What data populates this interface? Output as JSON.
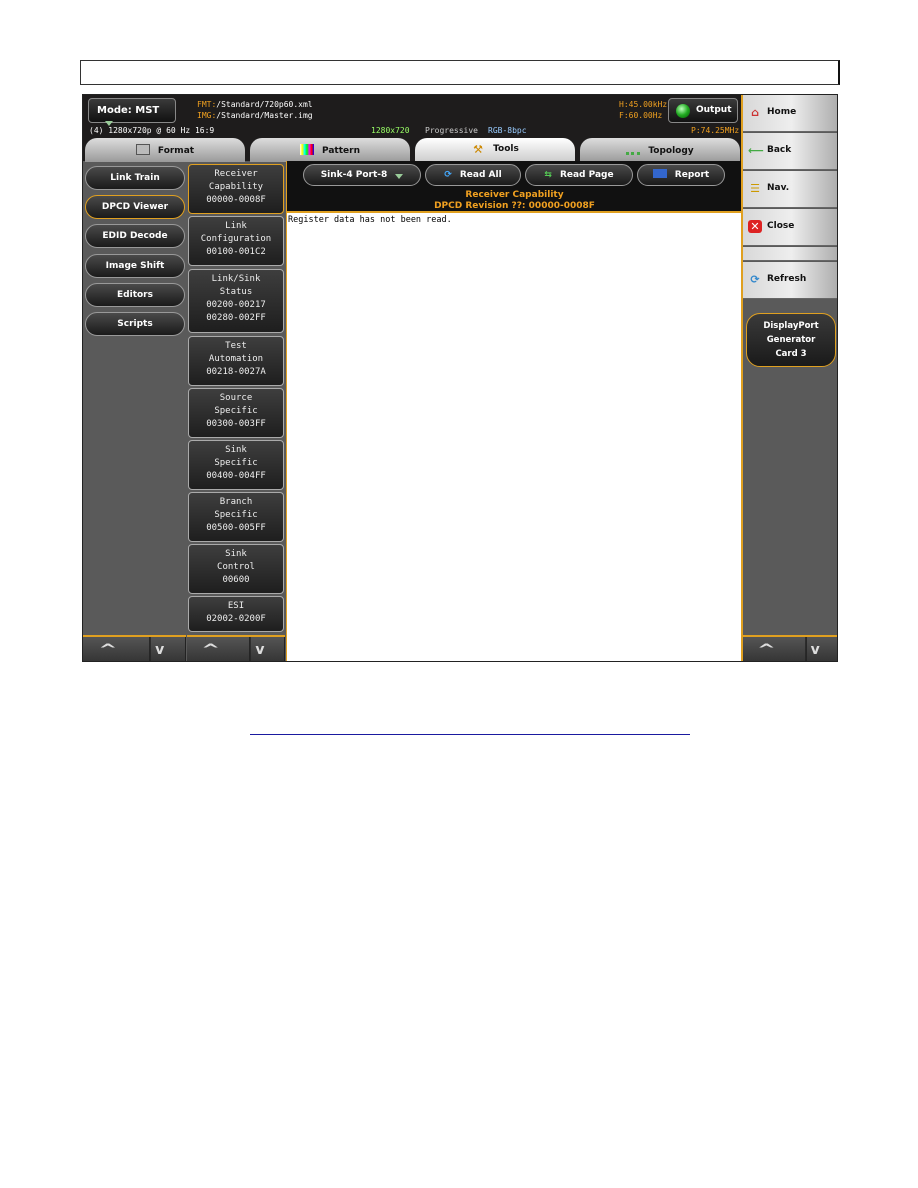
{
  "header": {
    "mode": "Mode: MST",
    "fmt_label": "FMT:",
    "fmt_path": "/Standard/720p60.xml",
    "img_label": "IMG:",
    "img_path": "/Standard/Master.img",
    "format_info": "(4) 1280x720p @ 60 Hz 16:9",
    "resolution": "1280x720",
    "scan": "Progressive",
    "color": "RGB-8bpc",
    "hfreq": "H:45.00kHz",
    "vfreq": "F:60.00Hz",
    "pclk": "P:74.25MHz",
    "output": "Output"
  },
  "tabs": [
    {
      "label": "Format"
    },
    {
      "label": "Pattern"
    },
    {
      "label": "Tools",
      "active": true
    },
    {
      "label": "Topology"
    }
  ],
  "left_menu": [
    {
      "label": "Link Train"
    },
    {
      "label": "DPCD Viewer",
      "selected": true
    },
    {
      "label": "EDID Decode"
    },
    {
      "label": "Image Shift"
    },
    {
      "label": "Editors"
    },
    {
      "label": "Scripts"
    }
  ],
  "registers": [
    {
      "lines": [
        "Receiver",
        "Capability",
        "00000-0008F"
      ],
      "selected": true
    },
    {
      "lines": [
        "Link",
        "Configuration",
        "00100-001C2"
      ]
    },
    {
      "lines": [
        "Link/Sink",
        "Status",
        "00200-00217",
        "00280-002FF"
      ]
    },
    {
      "lines": [
        "Test",
        "Automation",
        "00218-0027A"
      ]
    },
    {
      "lines": [
        "Source",
        "Specific",
        "00300-003FF"
      ]
    },
    {
      "lines": [
        "Sink",
        "Specific",
        "00400-004FF"
      ]
    },
    {
      "lines": [
        "Branch",
        "Specific",
        "00500-005FF"
      ]
    },
    {
      "lines": [
        "Sink",
        "Control",
        "00600"
      ]
    },
    {
      "lines": [
        "ESI",
        "02002-0200F"
      ]
    }
  ],
  "toolbar": {
    "sink": "Sink-4 Port-8",
    "read_all": "Read All",
    "read_page": "Read Page",
    "report": "Report"
  },
  "content": {
    "title": "Receiver Capability",
    "subtitle": "DPCD Revision ??: 00000-0008F",
    "message": "Register data has not been read."
  },
  "right_menu": {
    "home": "Home",
    "back": "Back",
    "nav": "Nav.",
    "close": "Close",
    "refresh": "Refresh",
    "card": [
      "DisplayPort",
      "Generator",
      "Card 3"
    ]
  },
  "arrows": {
    "up": "^",
    "down": "v"
  },
  "colors": {
    "accent": "#e0a020",
    "header_bg": "#1e1c1c"
  }
}
